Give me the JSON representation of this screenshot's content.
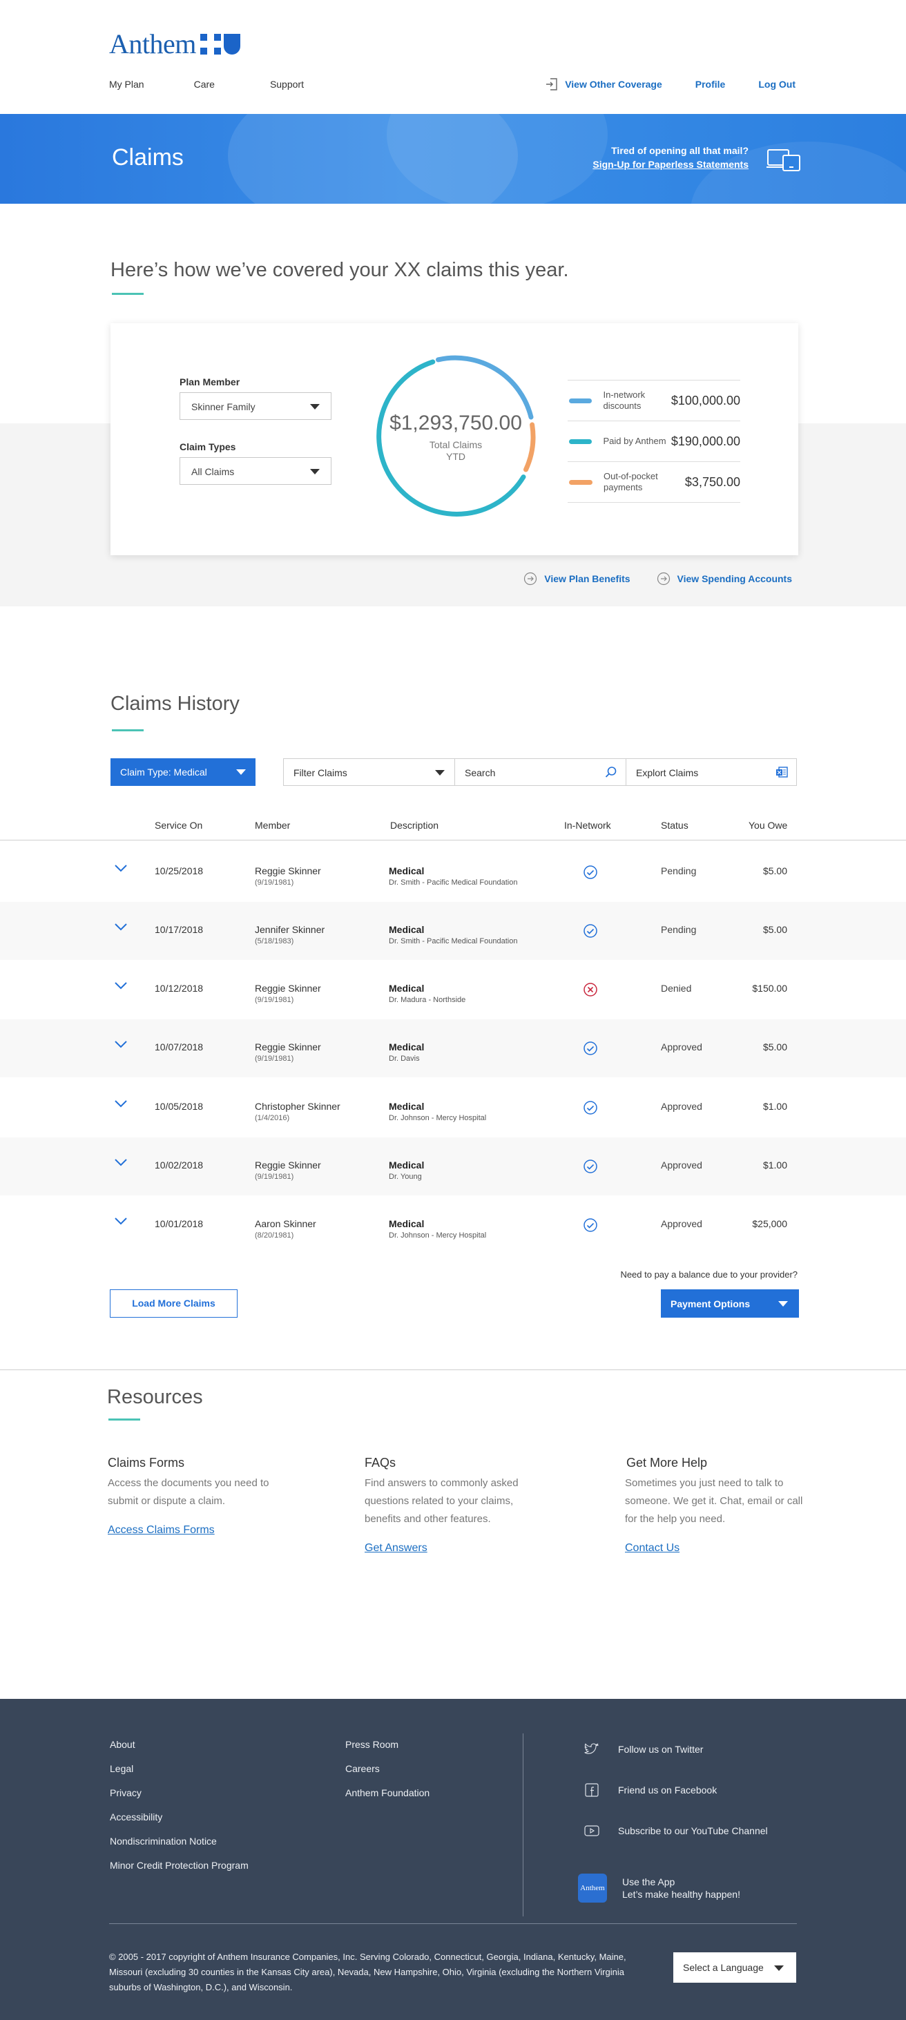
{
  "brand": {
    "name": "Anthem"
  },
  "nav": {
    "left": [
      "My Plan",
      "Care",
      "Support"
    ],
    "view_other_coverage": "View Other Coverage",
    "profile": "Profile",
    "logout": "Log Out"
  },
  "banner": {
    "title": "Claims",
    "promo_question": "Tired of opening all that mail?",
    "promo_link": "Sign-Up for Paperless Statements"
  },
  "summary": {
    "heading": "Here’s how we’ve covered your XX claims this year.",
    "plan_member_label": "Plan Member",
    "plan_member_value": "Skinner Family",
    "claim_types_label": "Claim Types",
    "claim_types_value": "All Claims",
    "total_amount": "$1,293,750.00",
    "total_label_line1": "Total Claims",
    "total_label_line2": "YTD",
    "legend": [
      {
        "label": "In-network discounts",
        "value": "$100,000.00",
        "color": "#5aa9df"
      },
      {
        "label": "Paid by Anthem",
        "value": "$190,000.00",
        "color": "#2db4c9"
      },
      {
        "label": "Out-of-pocket payments",
        "value": "$3,750.00",
        "color": "#f2a265"
      }
    ],
    "link_plan_benefits": "View Plan Benefits",
    "link_spending_accounts": "View Spending Accounts"
  },
  "history": {
    "heading": "Claims History",
    "claim_type_button": "Claim Type:  Medical",
    "filter_label": "Filter Claims",
    "search_placeholder": "Search",
    "export_label": "Explort Claims",
    "columns": {
      "service_on": "Service On",
      "member": "Member",
      "description": "Description",
      "in_network": "In-Network",
      "status": "Status",
      "you_owe": "You Owe"
    },
    "rows": [
      {
        "date": "10/25/2018",
        "member": "Reggie Skinner",
        "dob": "(9/19/1981)",
        "type": "Medical",
        "provider": "Dr. Smith - Pacific Medical Foundation",
        "in_network": true,
        "status": "Pending",
        "owe": "$5.00"
      },
      {
        "date": "10/17/2018",
        "member": "Jennifer Skinner",
        "dob": "(5/18/1983)",
        "type": "Medical",
        "provider": "Dr. Smith - Pacific Medical Foundation",
        "in_network": true,
        "status": "Pending",
        "owe": "$5.00"
      },
      {
        "date": "10/12/2018",
        "member": "Reggie Skinner",
        "dob": "(9/19/1981)",
        "type": "Medical",
        "provider": "Dr. Madura - Northside",
        "in_network": false,
        "status": "Denied",
        "owe": "$150.00"
      },
      {
        "date": "10/07/2018",
        "member": "Reggie Skinner",
        "dob": "(9/19/1981)",
        "type": "Medical",
        "provider": "Dr. Davis",
        "in_network": true,
        "status": "Approved",
        "owe": "$5.00"
      },
      {
        "date": "10/05/2018",
        "member": "Christopher Skinner",
        "dob": "(1/4/2016)",
        "type": "Medical",
        "provider": "Dr. Johnson - Mercy Hospital",
        "in_network": true,
        "status": "Approved",
        "owe": "$1.00"
      },
      {
        "date": "10/02/2018",
        "member": "Reggie Skinner",
        "dob": "(9/19/1981)",
        "type": "Medical",
        "provider": "Dr. Young",
        "in_network": true,
        "status": "Approved",
        "owe": "$1.00"
      },
      {
        "date": "10/01/2018",
        "member": "Aaron Skinner",
        "dob": "(8/20/1981)",
        "type": "Medical",
        "provider": "Dr. Johnson - Mercy Hospital",
        "in_network": true,
        "status": "Approved",
        "owe": "$25,000"
      }
    ],
    "balance_question": "Need to pay a balance due  to your provider?",
    "load_more": "Load More Claims",
    "payment_options": "Payment Options"
  },
  "resources": {
    "heading": "Resources",
    "items": [
      {
        "title": "Claims Forms",
        "text": "Access the documents you need to submit or dispute a claim.",
        "link": "Access Claims Forms"
      },
      {
        "title": "FAQs",
        "text": "Find answers to commonly asked questions related to your claims, benefits and other features.",
        "link": "Get Answers"
      },
      {
        "title": "Get More Help",
        "text": "Sometimes you just need to talk to someone. We get it. Chat, email or call for the help you need.",
        "link": "Contact Us"
      }
    ]
  },
  "footer": {
    "col1": [
      "About",
      "Legal",
      "Privacy",
      "Accessibility",
      "Nondiscrimination Notice",
      "Minor Credit Protection Program"
    ],
    "col2": [
      "Press Room",
      "Careers",
      "Anthem Foundation"
    ],
    "twitter": "Follow us on Twitter",
    "facebook": "Friend us on Facebook",
    "youtube": "Subscribe to our YouTube Channel",
    "app_line1": "Use the App",
    "app_line2": "Let’s make healthy happen!",
    "app_icon_text": "Anthem",
    "copyright": "© 2005 - 2017 copyright of Anthem Insurance Companies, Inc. Serving Colorado, Connecticut, Georgia, Indiana, Kentucky, Maine, Missouri (excluding 30 counties in the Kansas City area), Nevada, New Hampshire, Ohio, Virginia (excluding the Northern Virginia suburbs of Washington, D.C.), and Wisconsin.",
    "language": "Select a Language"
  },
  "colors": {
    "brand_blue": "#2270d8",
    "link_blue": "#1b6ec2",
    "accent_teal": "#4bc3b5",
    "footer_bg": "#394659",
    "denied_red": "#c9283e"
  }
}
